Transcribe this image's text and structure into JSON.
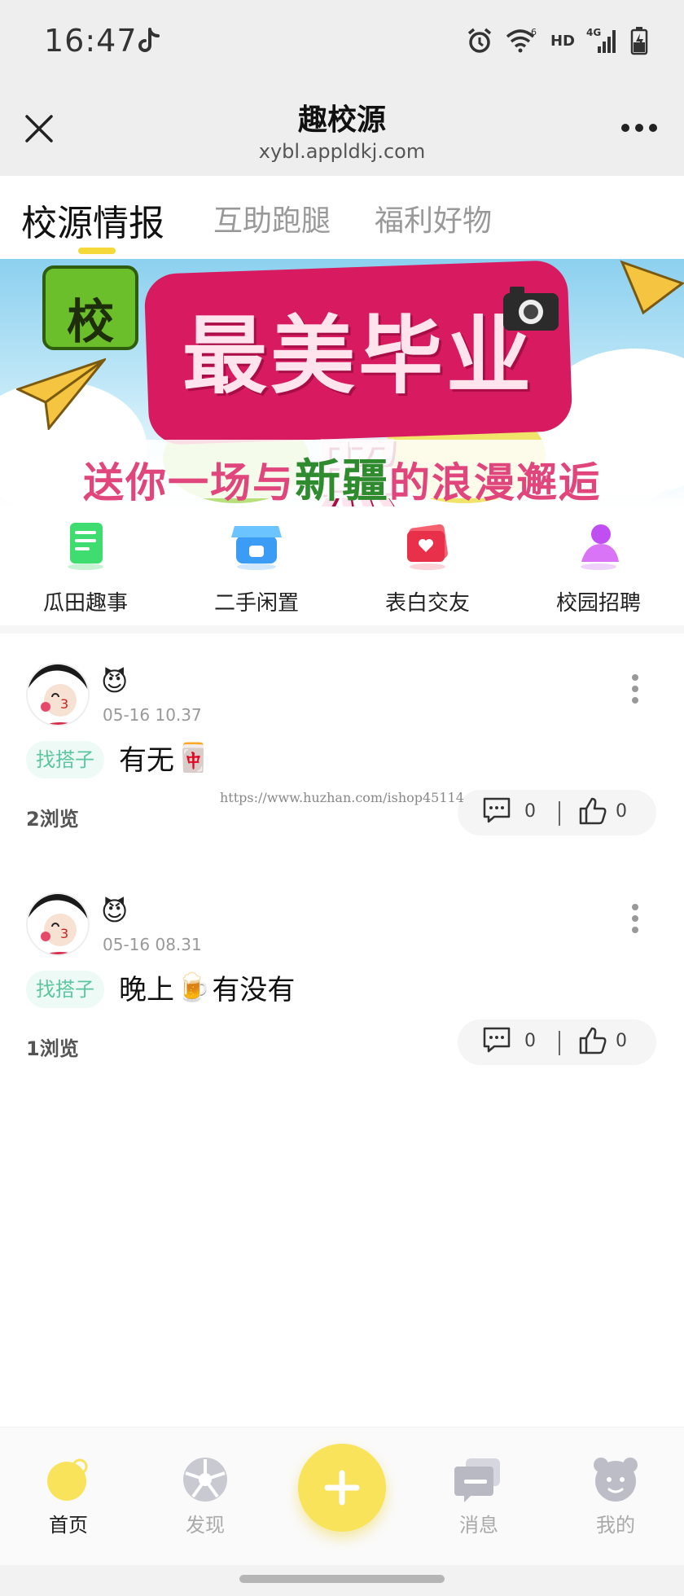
{
  "status_bar": {
    "time": "16:47",
    "hd": "HD",
    "network": "4G",
    "wifi_badge": "6",
    "icons": [
      "tiktok-icon",
      "alarm-icon",
      "wifi-icon",
      "signal-icon",
      "battery-icon"
    ]
  },
  "header": {
    "title": "趣校源",
    "url": "xybl.appldkj.com",
    "icons": [
      "close-icon",
      "more-icon"
    ]
  },
  "tabs": [
    {
      "label": "校源情报",
      "active": true
    },
    {
      "label": "互助跑腿",
      "active": false
    },
    {
      "label": "福利好物",
      "active": false
    }
  ],
  "banner": {
    "logo_text": "校",
    "title": "最美毕业照",
    "subtitle_before": "送你一场与",
    "subtitle_highlight": "新疆",
    "subtitle_after": "的浪漫邂逅"
  },
  "quick_menu": [
    {
      "label": "瓜田趣事",
      "icon": "scroll-icon",
      "color": "#39d66b"
    },
    {
      "label": "二手闲置",
      "icon": "shop-icon",
      "color": "#3b9cf5"
    },
    {
      "label": "表白交友",
      "icon": "love-letter-icon",
      "color": "#f0435b"
    },
    {
      "label": "校园招聘",
      "icon": "person-icon",
      "color": "#c04ef0"
    }
  ],
  "posts": [
    {
      "emoji": "😈",
      "date": "05-16 10.37",
      "tag": "找搭子",
      "text": "有无",
      "text_emoji": "🀄",
      "views": "2浏览",
      "comments": "0",
      "likes": "0"
    },
    {
      "emoji": "😈",
      "date": "05-16 08.31",
      "tag": "找搭子",
      "text_before": "晚上",
      "text_emoji": "🍺",
      "text_after": "有没有",
      "views": "1浏览",
      "comments": "0",
      "likes": "0"
    }
  ],
  "watermark": "https://www.huzhan.com/ishop45114",
  "bottom_nav": [
    {
      "label": "首页",
      "icon": "home-icon",
      "active": true
    },
    {
      "label": "发现",
      "icon": "discover-icon",
      "active": false
    },
    {
      "label": "",
      "icon": "plus-icon",
      "active": false
    },
    {
      "label": "消息",
      "icon": "message-icon",
      "active": false
    },
    {
      "label": "我的",
      "icon": "profile-icon",
      "active": false
    }
  ],
  "colors": {
    "accent_yellow": "#f9e35a",
    "tag_green": "#5cc6a0",
    "banner_pink": "#d81b60"
  }
}
